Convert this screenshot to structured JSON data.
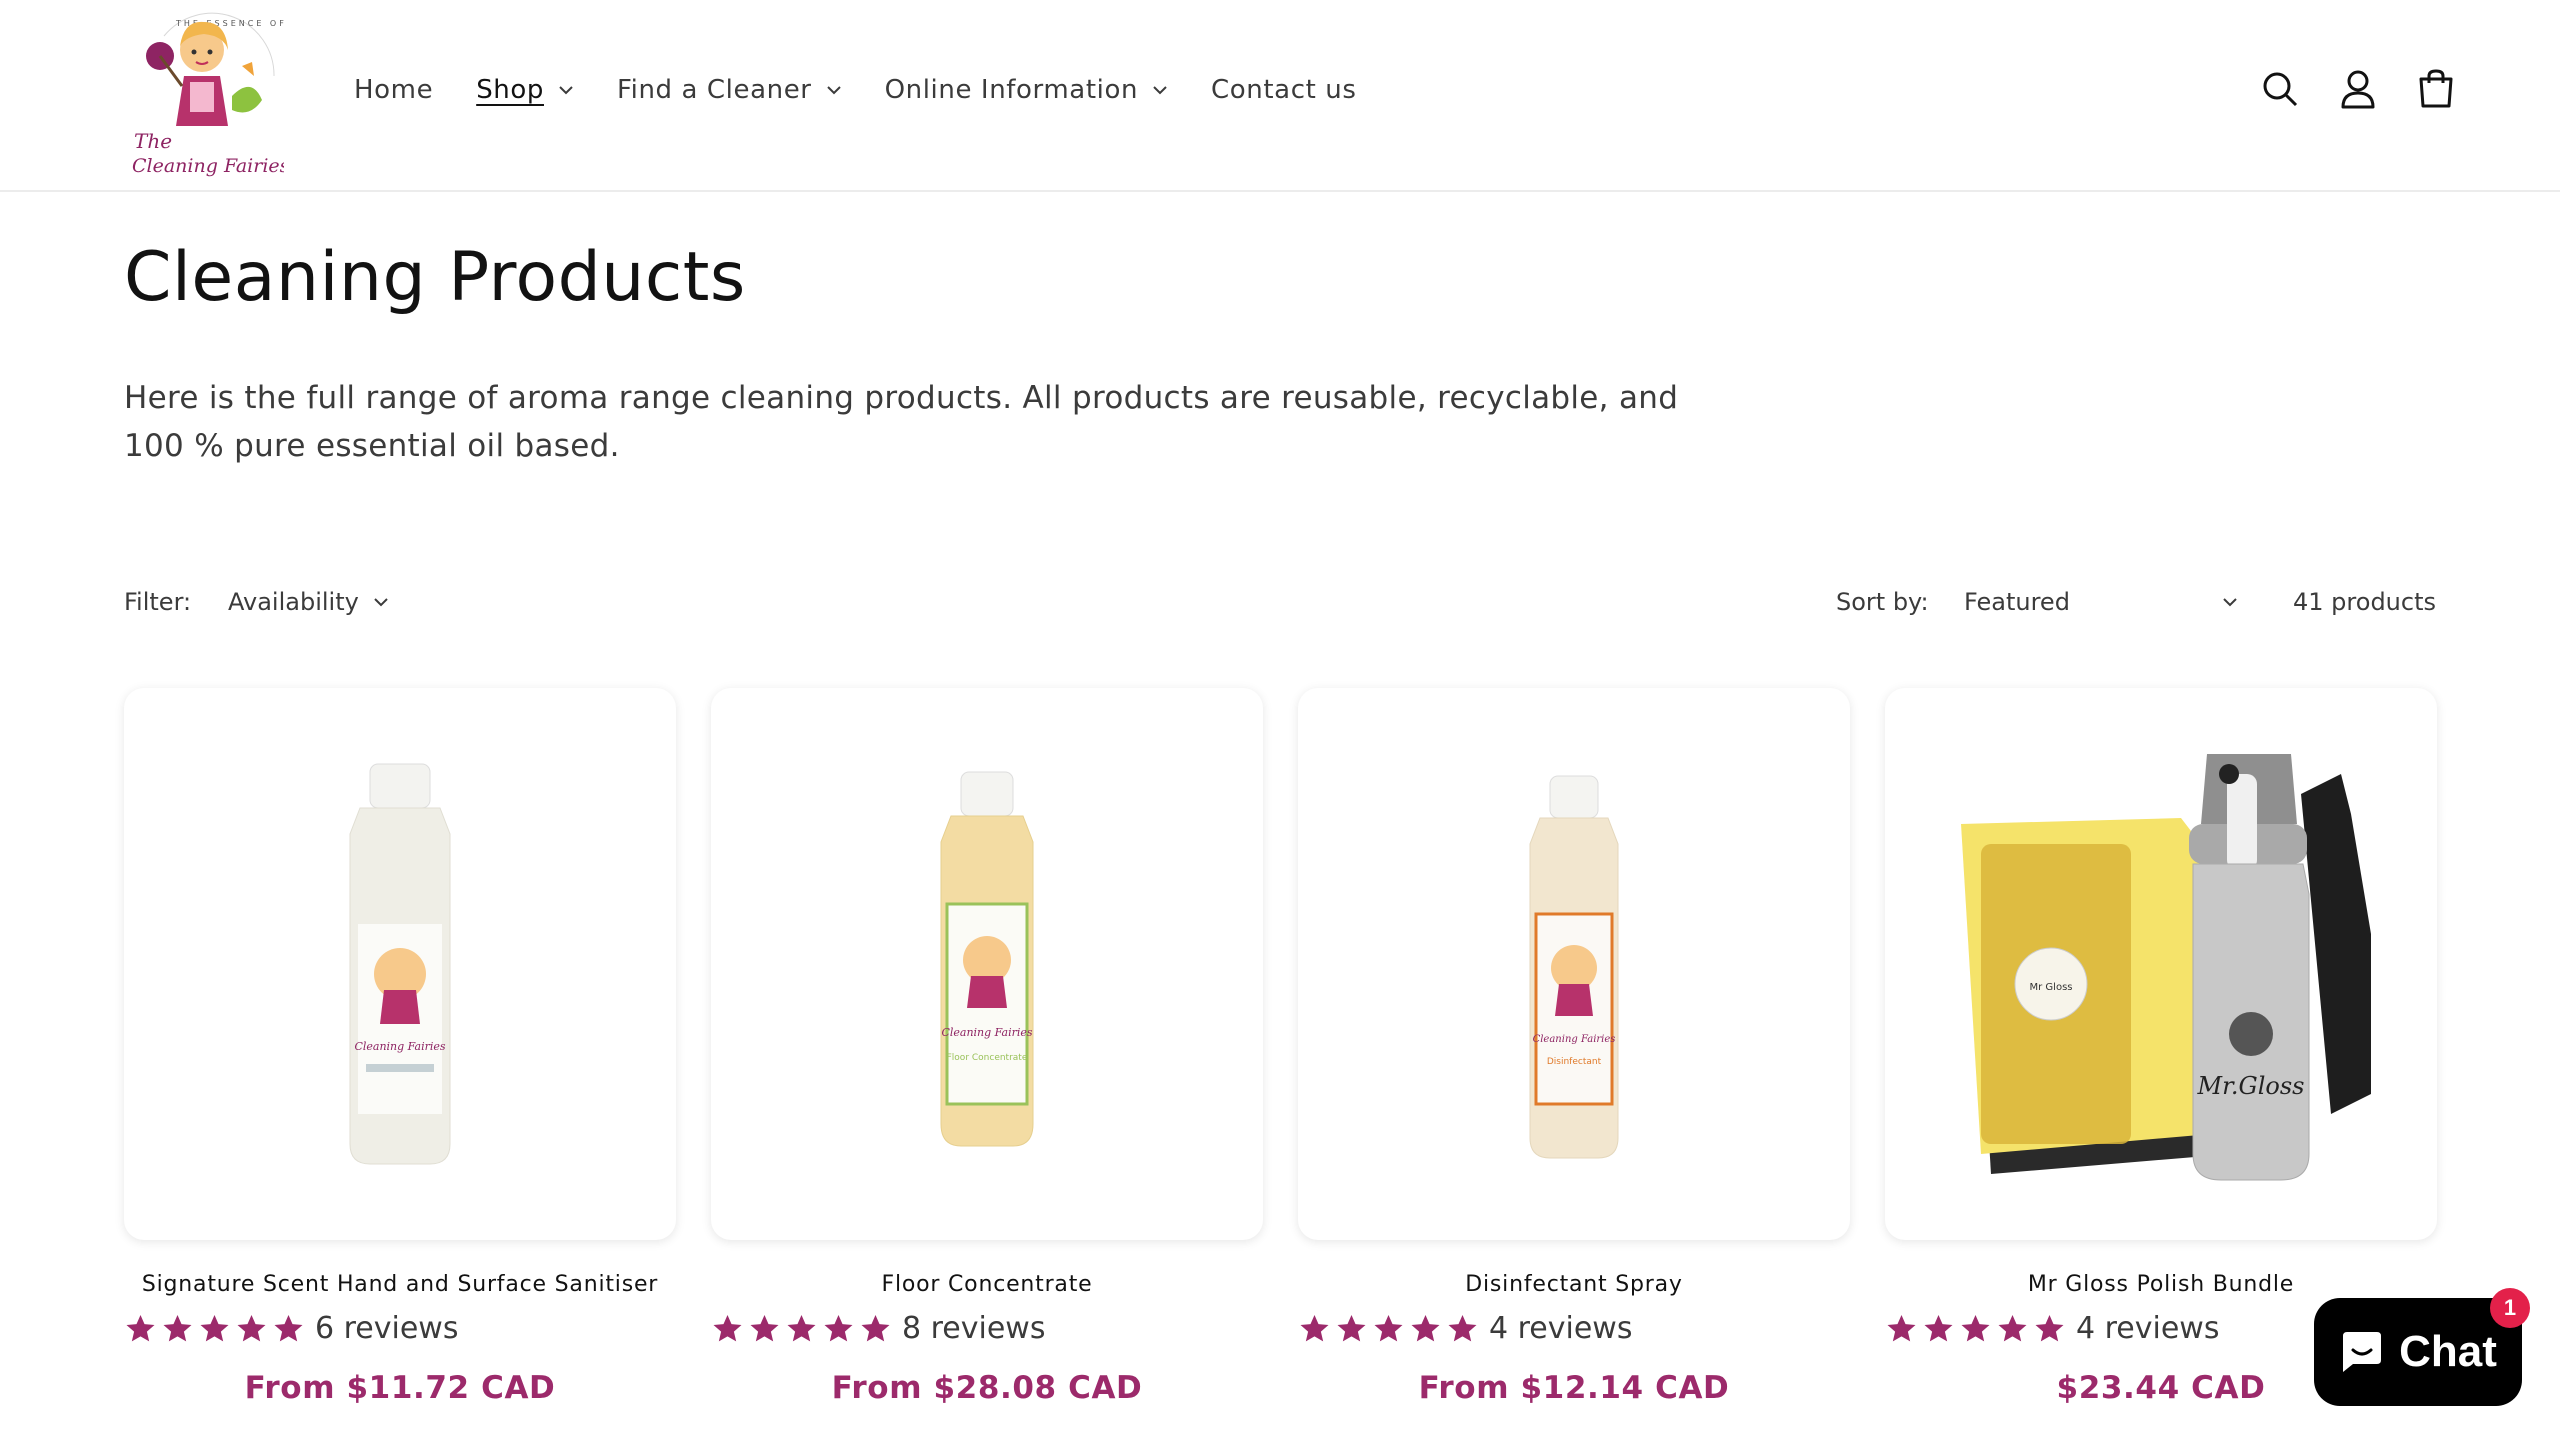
{
  "header": {
    "logo_text_top": "THE ESSENCE OF HOME",
    "logo_text_bottom": "The Cleaning Fairies",
    "nav": [
      {
        "label": "Home",
        "dropdown": false,
        "active": false
      },
      {
        "label": "Shop",
        "dropdown": true,
        "active": true
      },
      {
        "label": "Find a Cleaner",
        "dropdown": true,
        "active": false
      },
      {
        "label": "Online Information",
        "dropdown": true,
        "active": false
      },
      {
        "label": "Contact us",
        "dropdown": false,
        "active": false
      }
    ],
    "icons": [
      "search-icon",
      "account-icon",
      "cart-icon"
    ]
  },
  "collection": {
    "title": "Cleaning Products",
    "description": "Here is the full range of aroma range cleaning products.  All products are reusable, recyclable, and 100 % pure essential oil based."
  },
  "filter": {
    "filter_label": "Filter:",
    "availability_label": "Availability",
    "sort_label": "Sort by:",
    "sort_value": "Featured",
    "product_count": "41 products"
  },
  "products": [
    {
      "title": "Signature Scent Hand and Surface Sanitiser",
      "rating": 5,
      "reviews": "6 reviews",
      "price": "From $11.72 CAD",
      "image": "white-bottle"
    },
    {
      "title": "Floor Concentrate",
      "rating": 5,
      "reviews": "8 reviews",
      "price": "From $28.08 CAD",
      "image": "yellow-bottle"
    },
    {
      "title": "Disinfectant Spray",
      "rating": 5,
      "reviews": "4 reviews",
      "price": "From $12.14 CAD",
      "image": "cream-bottle"
    },
    {
      "title": "Mr Gloss Polish Bundle",
      "rating": 5,
      "reviews": "4 reviews",
      "price": "$23.44 CAD",
      "image": "gloss-bundle"
    }
  ],
  "chat": {
    "label": "Chat",
    "badge": "1"
  },
  "colors": {
    "accent": "#9c2a6b",
    "star": "#9c2a6b",
    "badge": "#e3214a"
  }
}
